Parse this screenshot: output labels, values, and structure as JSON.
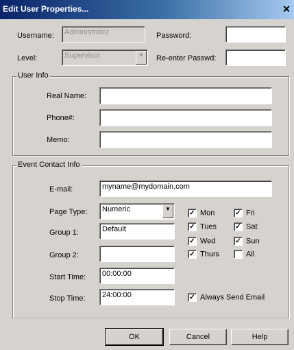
{
  "title": "Edit User Properties...",
  "user": {
    "username_label": "Username:",
    "username_value": "Administrator",
    "password_label": "Password:",
    "level_label": "Level:",
    "level_value": "Supervisor",
    "reenter_label": "Re-enter Passwd:"
  },
  "user_info": {
    "legend": "User Info",
    "real_name_label": "Real Name:",
    "phone_label": "Phone#:",
    "memo_label": "Memo:"
  },
  "event": {
    "legend": "Event Contact Info",
    "email_label": "E-mail:",
    "email_value": "myname@mydomain.com",
    "page_type_label": "Page Type:",
    "page_type_value": "Numeric",
    "group1_label": "Group 1:",
    "group1_value": "Default",
    "group2_label": "Group 2:",
    "start_label": "Start Time:",
    "start_value": "00:00:00",
    "stop_label": "Stop Time:",
    "stop_value": "24:00:00",
    "days": [
      {
        "label": "Mon",
        "checked": true
      },
      {
        "label": "Fri",
        "checked": true
      },
      {
        "label": "Tues",
        "checked": true
      },
      {
        "label": "Sat",
        "checked": true
      },
      {
        "label": "Wed",
        "checked": true
      },
      {
        "label": "Sun",
        "checked": true
      },
      {
        "label": "Thurs",
        "checked": true
      },
      {
        "label": "All",
        "checked": false
      }
    ],
    "always_email_label": "Always Send Email",
    "always_email_checked": true
  },
  "buttons": {
    "ok": "OK",
    "cancel": "Cancel",
    "help": "Help"
  }
}
